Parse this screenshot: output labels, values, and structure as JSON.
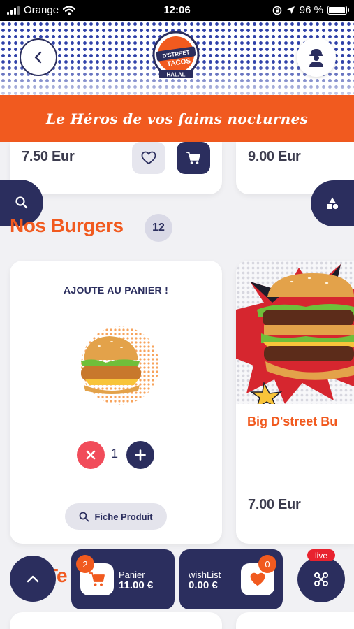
{
  "status_bar": {
    "carrier": "Orange",
    "time": "12:06",
    "battery": "96 %",
    "battery_level": 0.96
  },
  "header": {
    "back_icon": "chevron-left-icon",
    "user_icon": "worker-avatar-icon",
    "logo": {
      "line1": "D'STREET",
      "line2": "TACOS",
      "line3": "HALAL"
    }
  },
  "tagline": "Le Héros de vos faims nocturnes",
  "top_cards": [
    {
      "price": "7.50 Eur"
    },
    {
      "price": "9.00 Eur"
    }
  ],
  "section": {
    "title": "Nos Burgers",
    "count": "12"
  },
  "burger_card": {
    "title": "AJOUTE AU PANIER !",
    "quantity": "1",
    "product_button": "Fiche Produit"
  },
  "burger_card_2": {
    "name": "Big D'street Bu",
    "price": "7.00 Eur"
  },
  "bottom_bar": {
    "panier": {
      "badge": "2",
      "label": "Panier",
      "value": "11.00 €"
    },
    "wishlist": {
      "badge": "0",
      "label": "wishList",
      "value": "0.00 €"
    },
    "live_badge": "live",
    "next_section_partial": "Te"
  },
  "colors": {
    "accent": "#f15a1f",
    "navy": "#2b2e5e",
    "minus": "#f14c5a",
    "live": "#e8232f"
  }
}
